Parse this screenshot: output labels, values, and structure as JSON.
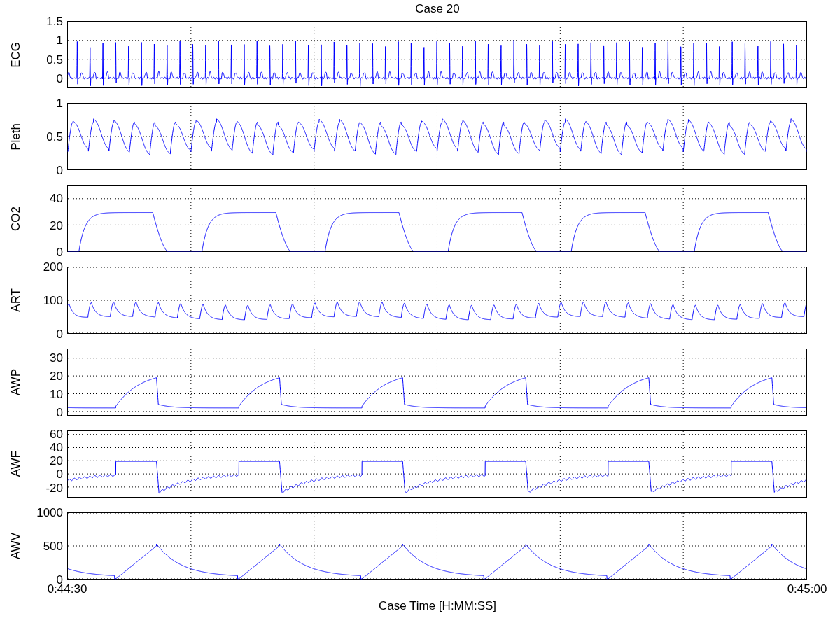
{
  "title": "Case 20",
  "panels": [
    {
      "kind": "ecg",
      "ylabel": "ECG",
      "yticks": [
        "1.5",
        "1",
        "0.5",
        "0"
      ]
    },
    {
      "kind": "pleth",
      "ylabel": "Pleth",
      "yticks": [
        "1",
        "0.5",
        "0"
      ]
    },
    {
      "kind": "co2",
      "ylabel": "CO2",
      "yticks": [
        "40",
        "20",
        "0"
      ]
    },
    {
      "kind": "art",
      "ylabel": "ART",
      "yticks": [
        "200",
        "100",
        "0"
      ]
    },
    {
      "kind": "awp",
      "ylabel": "AWP",
      "yticks": [
        "30",
        "20",
        "10",
        "0"
      ]
    },
    {
      "kind": "awf",
      "ylabel": "AWF",
      "yticks": [
        "60",
        "40",
        "20",
        "0",
        "-20"
      ]
    },
    {
      "kind": "awv",
      "ylabel": "AWV",
      "yticks": [
        "1000",
        "500",
        "0"
      ]
    }
  ],
  "x_axis": {
    "ticks": [
      "0:44:30",
      "0:45:00"
    ],
    "label": "Case Time [H:MM:SS]"
  }
}
